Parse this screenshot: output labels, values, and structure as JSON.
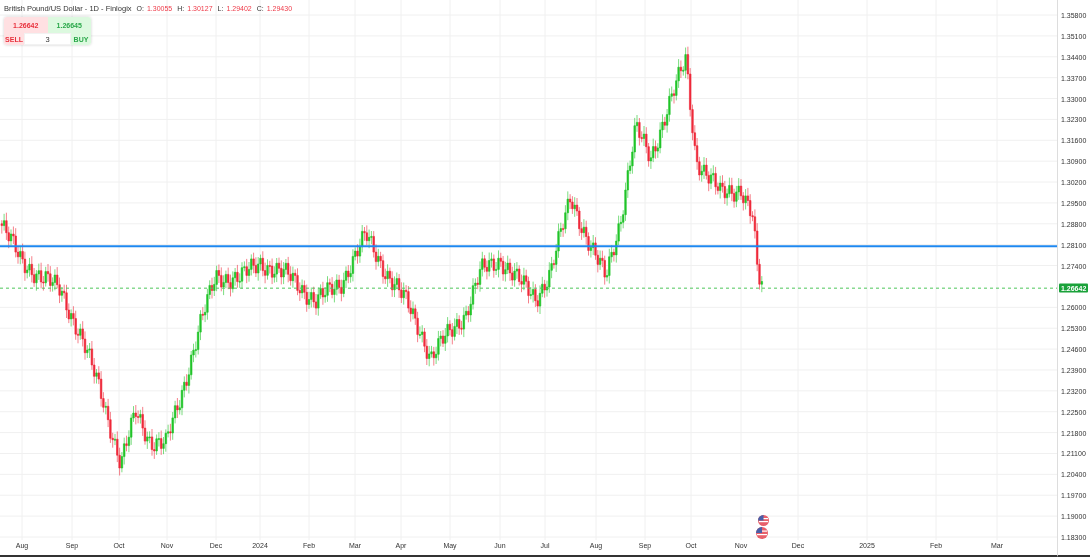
{
  "header": {
    "title": "British Pound/US Dollar - 1D - Finlogix",
    "ohlc": [
      {
        "label": "O:",
        "value": "1.30055"
      },
      {
        "label": "H:",
        "value": "1.30127"
      },
      {
        "label": "L:",
        "value": "1.29402"
      },
      {
        "label": "C:",
        "value": "1.29430"
      }
    ]
  },
  "trade": {
    "sell_price": "1.26642",
    "buy_price": "1.26645",
    "sell_label": "SELL",
    "buy_label": "BUY",
    "quantity": "3"
  },
  "price_axis": {
    "ticks": [
      "1.35800",
      "1.35100",
      "1.34400",
      "1.33700",
      "1.33000",
      "1.32300",
      "1.31600",
      "1.30900",
      "1.30200",
      "1.29500",
      "1.28800",
      "1.28100",
      "1.27400",
      "1.26000",
      "1.25300",
      "1.24600",
      "1.23900",
      "1.23200",
      "1.22500",
      "1.21800",
      "1.21100",
      "1.20400",
      "1.19700",
      "1.19000",
      "1.18300"
    ],
    "current_price": "1.26642"
  },
  "time_axis": {
    "ticks": [
      "Aug",
      "Sep",
      "Oct",
      "Nov",
      "Dec",
      "2024",
      "Feb",
      "Mar",
      "Apr",
      "May",
      "Jun",
      "Jul",
      "Aug",
      "Sep",
      "Oct",
      "Nov",
      "Dec",
      "2025",
      "Feb",
      "Mar"
    ]
  }
}
